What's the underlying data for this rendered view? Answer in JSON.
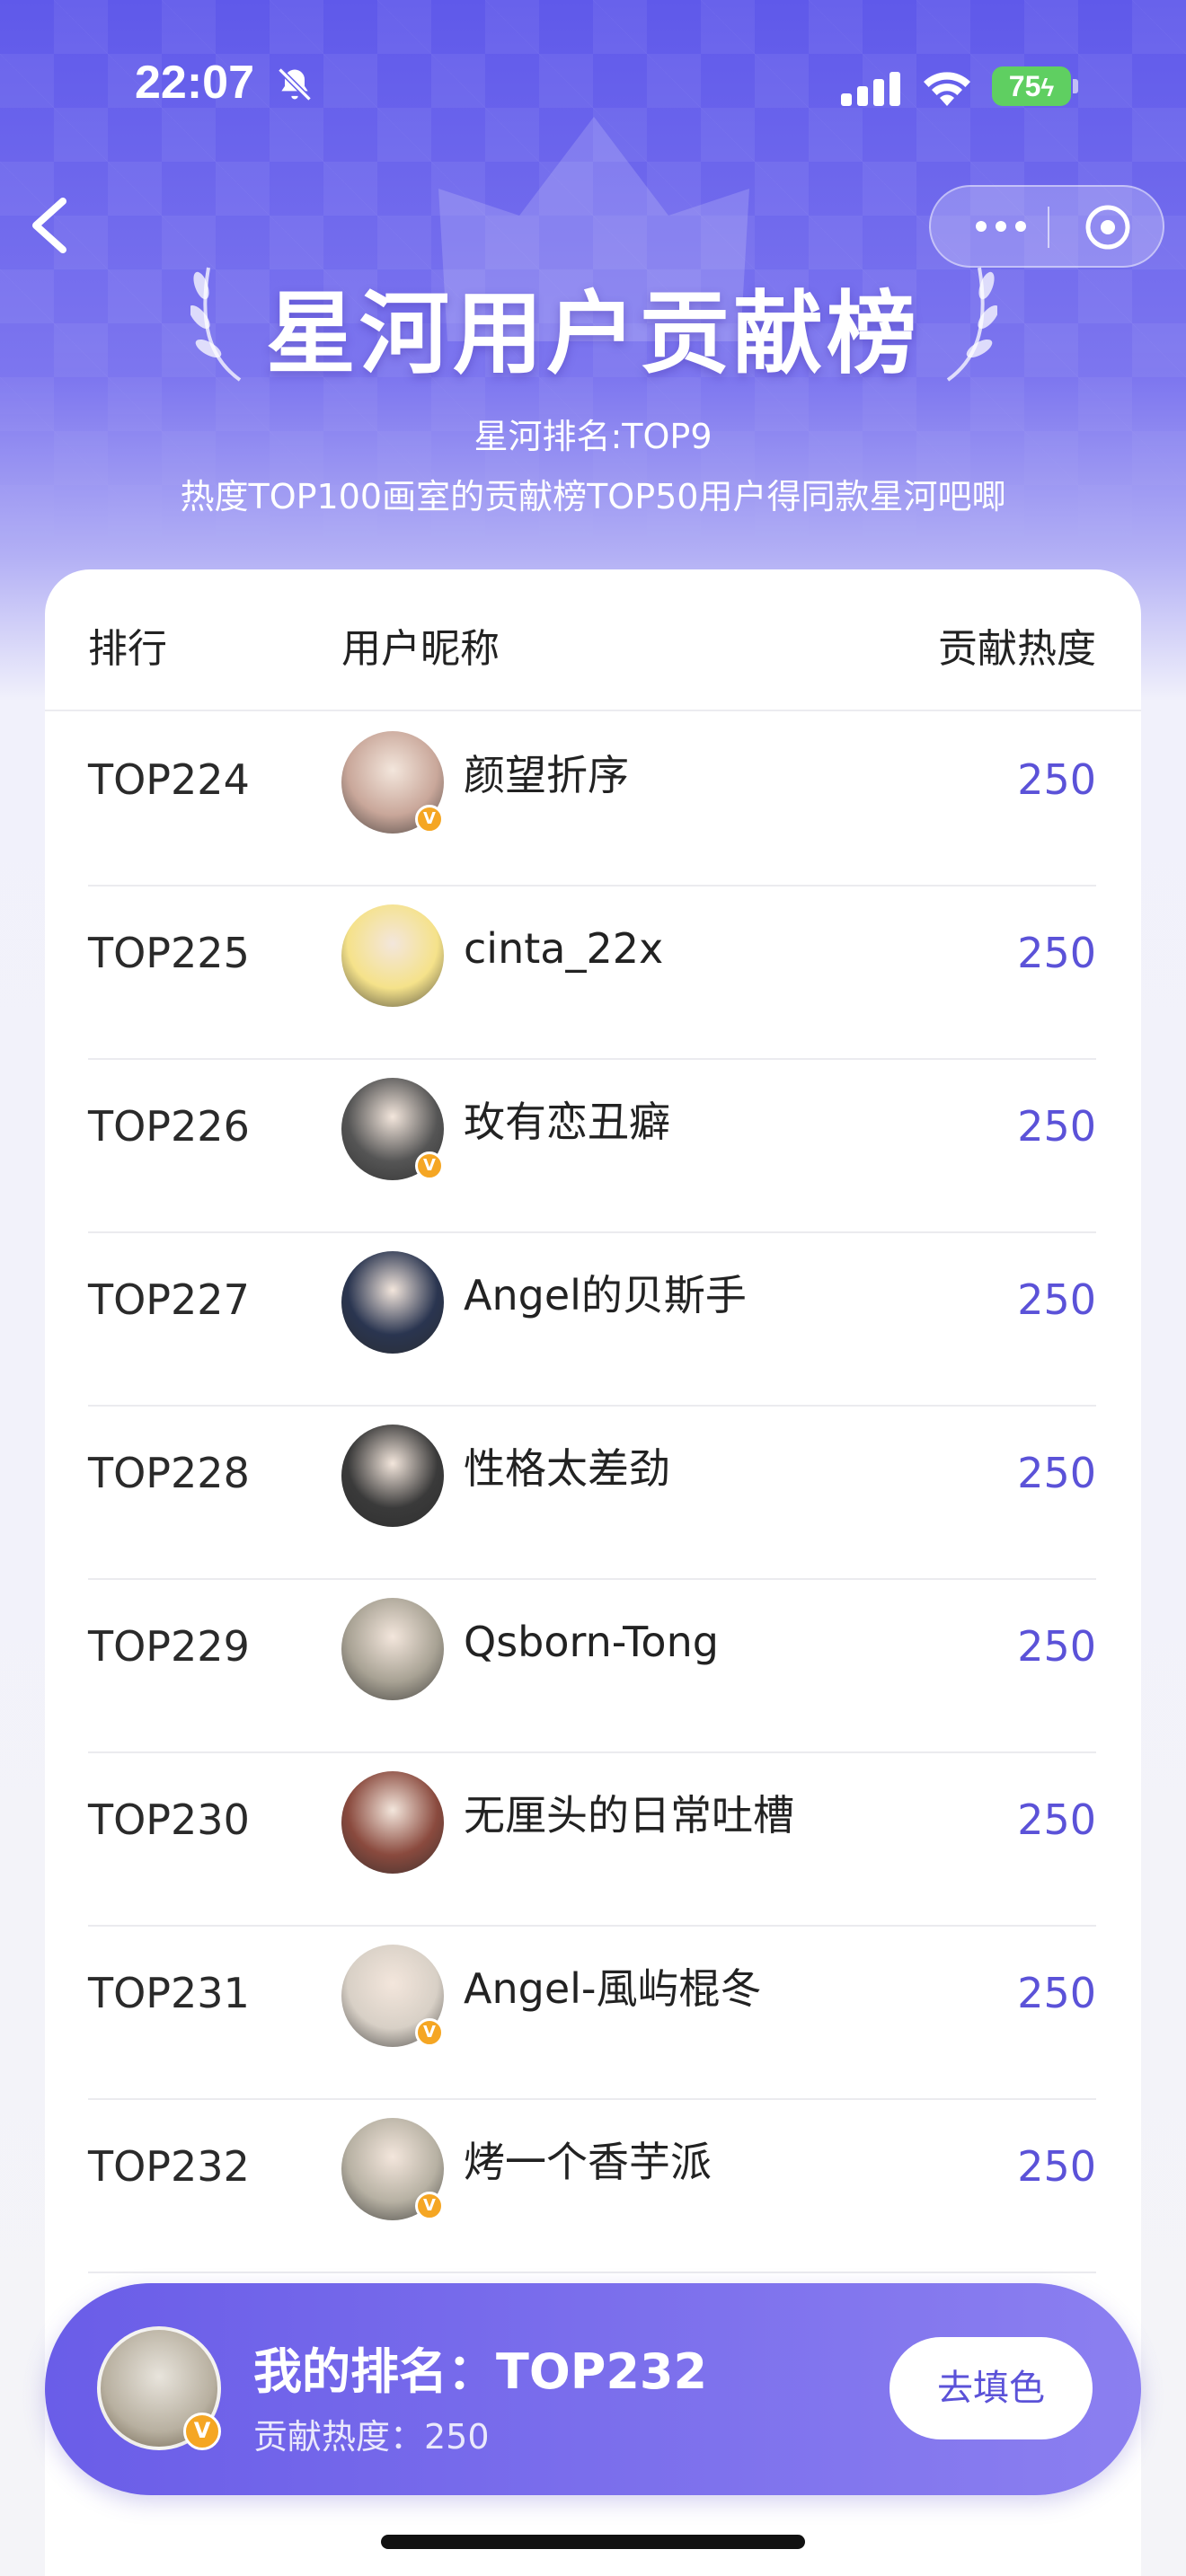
{
  "status_bar": {
    "time": "22:07",
    "battery": "75"
  },
  "header": {
    "title": "星河用户贡献榜",
    "subtitle_rank": "星河排名:TOP9",
    "subtitle_desc": "热度TOP100画室的贡献榜TOP50用户得同款星河吧唧"
  },
  "table": {
    "col_rank": "排行",
    "col_name": "用户昵称",
    "col_heat": "贡献热度",
    "rows": [
      {
        "rank": "TOP224",
        "name": "颜望折序",
        "heat": "250",
        "verified": true,
        "avatar_color": "#c9a79a"
      },
      {
        "rank": "TOP225",
        "name": "cinta_22x",
        "heat": "250",
        "verified": false,
        "avatar_color": "#f5e28a"
      },
      {
        "rank": "TOP226",
        "name": "玫有恋丑癖",
        "heat": "250",
        "verified": true,
        "avatar_color": "#555555"
      },
      {
        "rank": "TOP227",
        "name": "Angel的贝斯手",
        "heat": "250",
        "verified": false,
        "avatar_color": "#2a3550"
      },
      {
        "rank": "TOP228",
        "name": "性格太差劲",
        "heat": "250",
        "verified": false,
        "avatar_color": "#3a3a3a"
      },
      {
        "rank": "TOP229",
        "name": "Qsborn-Tong",
        "heat": "250",
        "verified": false,
        "avatar_color": "#a8a294"
      },
      {
        "rank": "TOP230",
        "name": "无厘头的日常吐槽",
        "heat": "250",
        "verified": false,
        "avatar_color": "#8a4a3e"
      },
      {
        "rank": "TOP231",
        "name": "Angel-風屿棍冬",
        "heat": "250",
        "verified": true,
        "avatar_color": "#d8d0c6"
      },
      {
        "rank": "TOP232",
        "name": "烤一个香芋派",
        "heat": "250",
        "verified": true,
        "avatar_color": "#b7b1a3"
      }
    ]
  },
  "my_rank": {
    "rank_text": "我的排名：TOP232",
    "heat_text": "贡献热度：250",
    "button_label": "去填色"
  },
  "icons": {
    "back": "back-chevron-icon",
    "more": "more-dots-icon",
    "close": "close-circle-icon",
    "mute": "bell-slash-icon",
    "signal": "signal-icon",
    "wifi": "wifi-icon",
    "crown": "crown-icon",
    "laurel": "laurel-icon",
    "verified": "verified-badge-icon"
  },
  "colors": {
    "accent": "#5b52d8",
    "header_top": "#5f59ea",
    "badge": "#f5a623"
  }
}
